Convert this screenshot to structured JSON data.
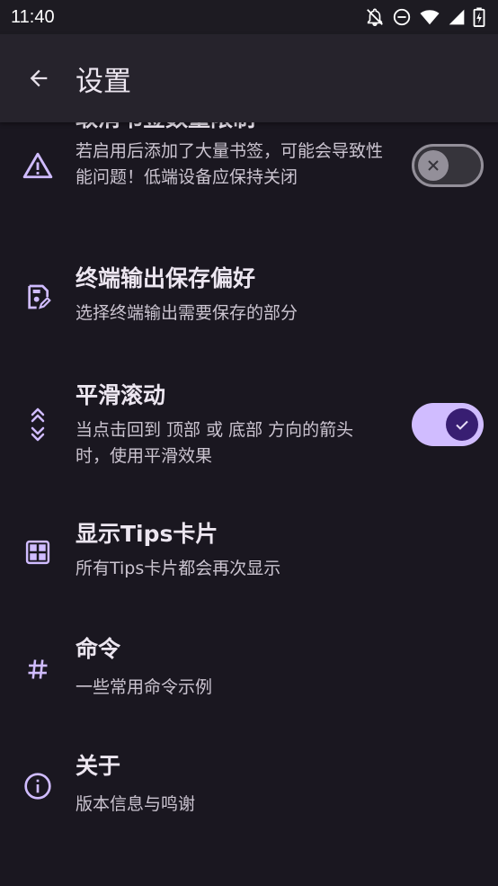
{
  "status_bar": {
    "time": "11:40"
  },
  "app_bar": {
    "title": "设置"
  },
  "settings": [
    {
      "title": "取消书签数量限制",
      "desc": "若启用后添加了大量书签，可能会导致性能问题！低端设备应保持关闭",
      "icon": "warning-icon",
      "switch": "off"
    },
    {
      "title": "终端输出保存偏好",
      "desc": "选择终端输出需要保存的部分",
      "icon": "save-edit-icon"
    },
    {
      "title": "平滑滚动",
      "desc": "当点击回到 顶部 或 底部 方向的箭头时，使用平滑效果",
      "icon": "double-chevron-icon",
      "switch": "on"
    },
    {
      "title": "显示Tips卡片",
      "desc": "所有Tips卡片都会再次显示",
      "icon": "grid-icon"
    },
    {
      "title": "命令",
      "desc": "一些常用命令示例",
      "icon": "hash-icon"
    },
    {
      "title": "关于",
      "desc": "版本信息与鸣谢",
      "icon": "info-icon"
    }
  ],
  "colors": {
    "accent": "#d0bcff",
    "background": "#1a1720",
    "app_bar": "#26232c"
  }
}
